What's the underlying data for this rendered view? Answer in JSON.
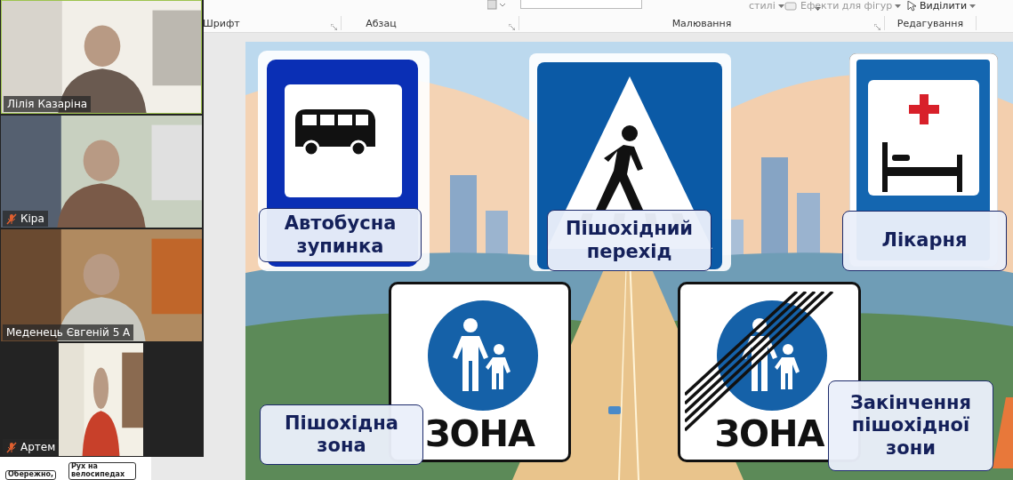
{
  "ribbon": {
    "top_items": [
      {
        "label": "стилі",
        "kind": "dropdown"
      },
      {
        "label": "Ефекти для фігур",
        "kind": "dropdown"
      },
      {
        "label": "Виділити",
        "kind": "dropdown"
      }
    ],
    "groups": [
      {
        "label": "Шрифт"
      },
      {
        "label": "Абзац"
      },
      {
        "label": "Малювання"
      },
      {
        "label": "Редагування"
      }
    ]
  },
  "participants": [
    {
      "name": "Лілія Казаріна",
      "muted": false,
      "speaking": true,
      "kind": "picture"
    },
    {
      "name": "Кіра",
      "muted": true,
      "speaking": false,
      "kind": "picture"
    },
    {
      "name": "Меденець Євгеній 5 А",
      "muted": false,
      "speaking": false,
      "kind": "picture"
    },
    {
      "name": "Артем",
      "muted": true,
      "speaking": false,
      "kind": "picture"
    }
  ],
  "thumbnail_strip": [
    {
      "text": "Обережно,"
    },
    {
      "text": "Рух на велосипедах"
    }
  ],
  "slide": {
    "signs": [
      {
        "kind": "bus",
        "label": "Автобусна зупинка"
      },
      {
        "kind": "crossing",
        "label": "Пішохідний перехід"
      },
      {
        "kind": "hospital",
        "label": "Лікарня"
      },
      {
        "kind": "zone",
        "label": "Пішохідна зона",
        "sign_text": "ЗОНА"
      },
      {
        "kind": "zone_end",
        "label": "Закінчення пішохідної зони",
        "sign_text": "ЗОНА"
      }
    ]
  }
}
